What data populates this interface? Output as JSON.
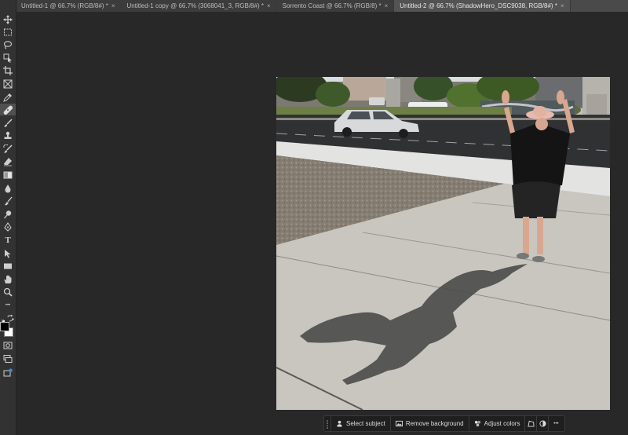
{
  "tabs": [
    {
      "label": "Untitled-1 @ 66.7% (RGB/8#) *",
      "close": "×"
    },
    {
      "label": "Untitled-1 copy @ 66.7% (3068041_3, RGB/8#) *",
      "close": "×"
    },
    {
      "label": "Sorrento Coast @ 66.7% (RGB/8) *",
      "close": "×"
    },
    {
      "label": "Untitled-2 @ 66.7% (ShadowHero_DSC9038, RGB/8#) *",
      "close": "×"
    }
  ],
  "tools": [
    "move-tool-icon",
    "marquee-tool-icon",
    "lasso-tool-icon",
    "object-select-tool-icon",
    "crop-tool-icon",
    "frame-tool-icon",
    "eyedropper-tool-icon",
    "healing-brush-tool-icon",
    "brush-tool-icon",
    "clone-stamp-tool-icon",
    "history-brush-tool-icon",
    "eraser-tool-icon",
    "gradient-tool-icon",
    "blur-tool-icon",
    "smudge-tool-icon",
    "dodge-tool-icon",
    "pen-tool-icon",
    "type-tool-icon",
    "path-select-tool-icon",
    "rectangle-tool-icon",
    "hand-tool-icon",
    "zoom-tool-icon",
    "more-tools-icon"
  ],
  "type_tool_glyph": "T",
  "more_tools_glyph": "•••",
  "contextual_taskbar": {
    "select_subject": "Select subject",
    "remove_background": "Remove background",
    "adjust_colors": "Adjust colors",
    "more_glyph": "•••"
  },
  "colors": {
    "foreground": "#000000",
    "background": "#ffffff"
  }
}
